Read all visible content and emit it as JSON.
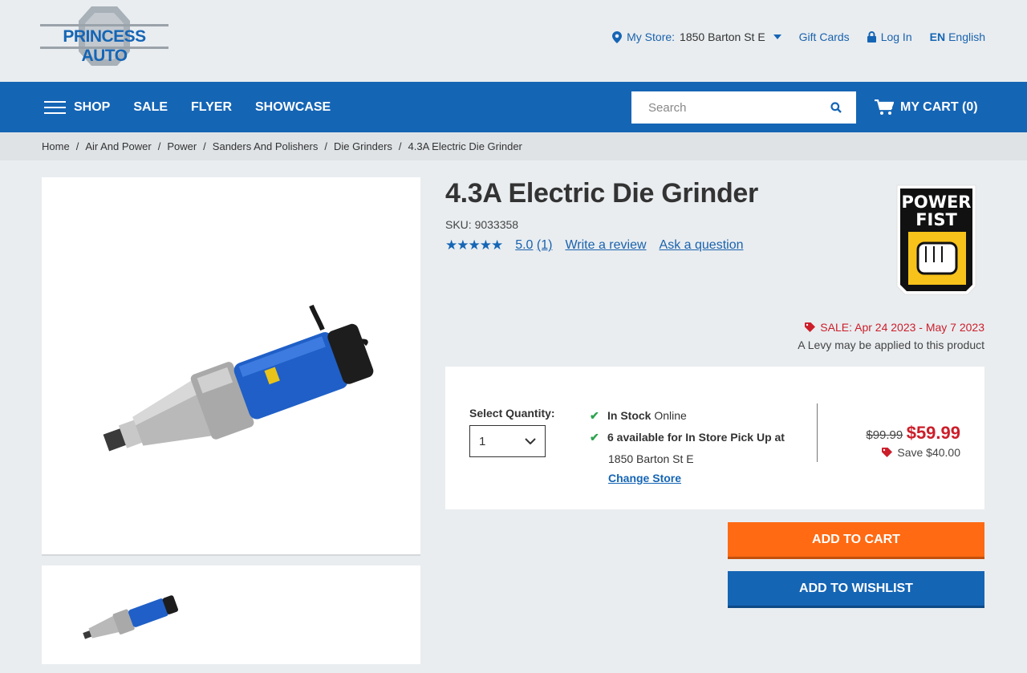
{
  "header": {
    "logo_text": "PRINCESS AUTO",
    "store_label": "My Store:",
    "store_name": "1850 Barton St E",
    "gift_cards": "Gift Cards",
    "login": "Log In",
    "lang_code": "EN",
    "lang_name": "English"
  },
  "nav": {
    "items": [
      "SHOP",
      "SALE",
      "FLYER",
      "SHOWCASE"
    ],
    "search_placeholder": "Search",
    "cart_label": "MY CART (0)"
  },
  "breadcrumb": [
    "Home",
    "Air And Power",
    "Power",
    "Sanders And Polishers",
    "Die Grinders",
    "4.3A Electric Die Grinder"
  ],
  "product": {
    "title": "4.3A Electric Die Grinder",
    "sku": "SKU: 9033358",
    "stars": "★★★★★",
    "rating": "5.0",
    "review_count": "(1)",
    "write_review": "Write a review",
    "ask_question": "Ask a question",
    "brand_line1": "POWER",
    "brand_line2": "FIST",
    "sale_text": "SALE: Apr 24 2023 - May 7 2023",
    "levy_text": "A Levy may be applied to this product"
  },
  "buybox": {
    "qty_label": "Select Quantity:",
    "qty_value": "1",
    "stock_bold": "In Stock",
    "stock_rest": " Online",
    "pickup_text": "6 available for In Store Pick Up at",
    "pickup_store": "1850 Barton St E",
    "change_store": "Change Store",
    "was_price": "$99.99",
    "now_price": "$59.99",
    "save_text": "Save $40.00"
  },
  "actions": {
    "add_to_cart": "ADD TO CART",
    "add_to_wishlist": "ADD TO WISHLIST"
  },
  "colors": {
    "brand_blue": "#1565b5",
    "sale_red": "#cc1e2a",
    "cart_orange": "#ff6a13"
  }
}
